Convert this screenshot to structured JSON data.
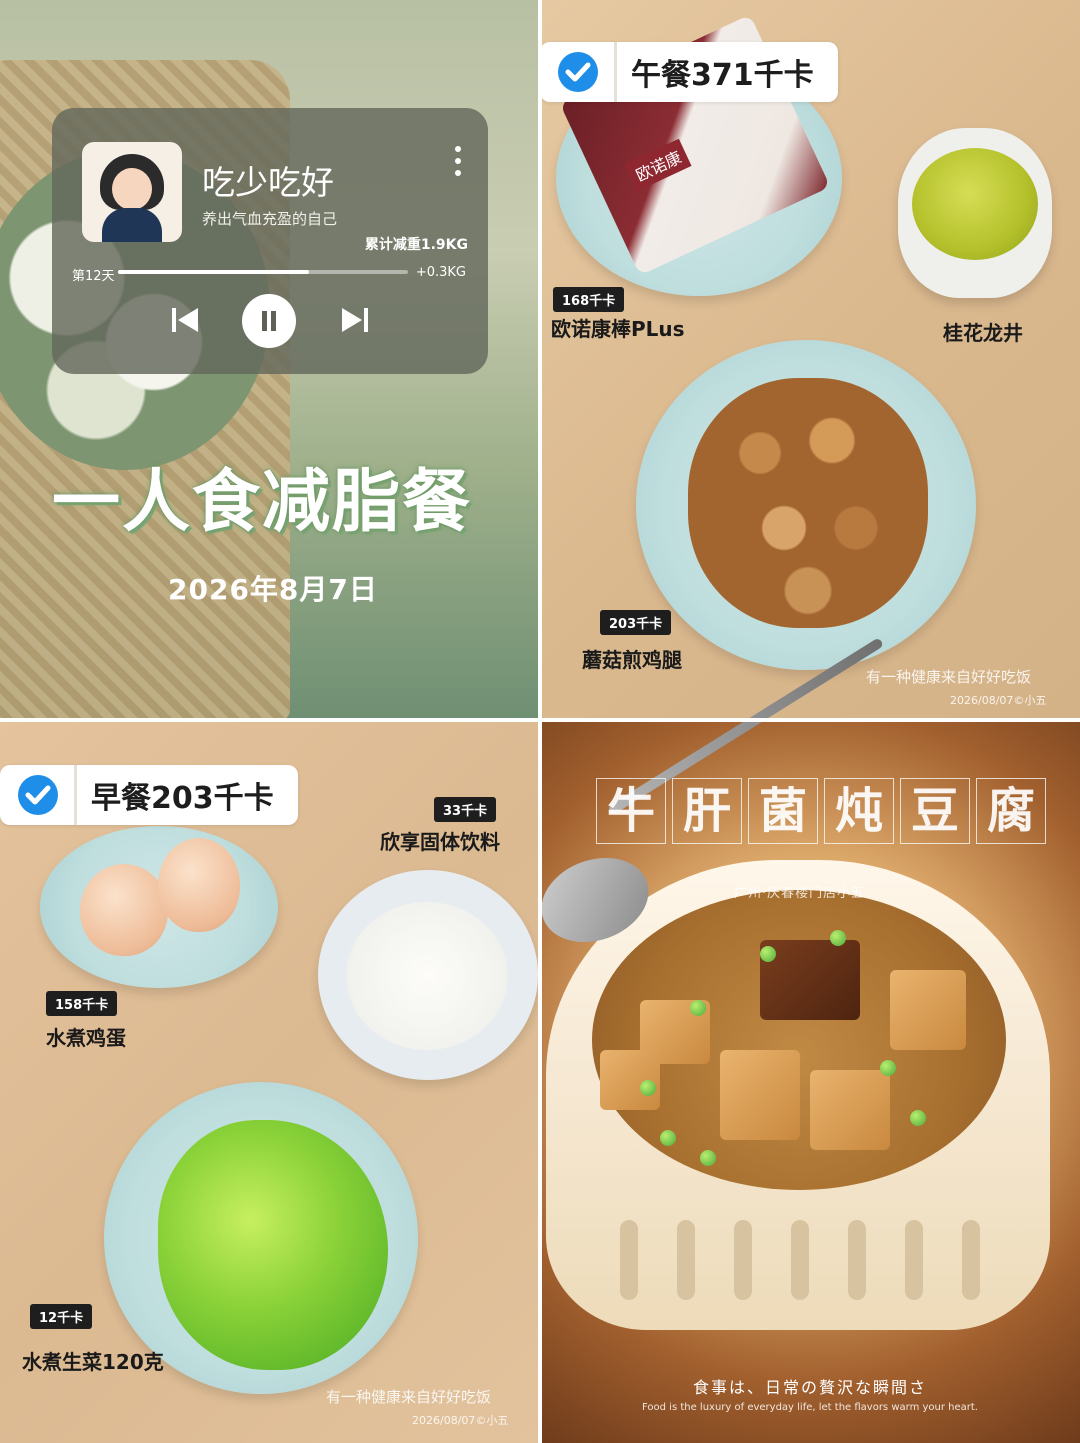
{
  "player": {
    "title": "吃少吃好",
    "subtitle": "养出气血充盈的自己",
    "stat_main": "累计减重1.9KG",
    "day_label": "第12天",
    "stat_right": "+0.3KG",
    "progress": 0.66
  },
  "cover": {
    "title": "一人食减脂餐",
    "date": "2026年8月7日"
  },
  "lunch": {
    "badge": "午餐371千卡",
    "items": [
      {
        "kcal": "168千卡",
        "name": "欧诺康棒PLus"
      },
      {
        "kcal": "",
        "name": "桂花龙井"
      },
      {
        "kcal": "203千卡",
        "name": "蘑菇煎鸡腿"
      }
    ],
    "snack_logo": "欧诺康",
    "watermark_line1": "有一种健康来自好好吃饭",
    "watermark_line2": "2026/08/07©小五"
  },
  "breakfast": {
    "badge": "早餐203千卡",
    "items": [
      {
        "kcal": "33千卡",
        "name": "欣享固体饮料"
      },
      {
        "kcal": "158千卡",
        "name": "水煮鸡蛋"
      },
      {
        "kcal": "12千卡",
        "name": "水煮生菜120克"
      }
    ],
    "watermark_line1": "有一种健康来自好好吃饭",
    "watermark_line2": "2026/08/07©小五"
  },
  "dinner": {
    "title_chars": [
      "牛",
      "肝",
      "菌",
      "炖",
      "豆",
      "腐"
    ],
    "subtitle": "广州·庆春楼门店小五",
    "caption_jp": "食事は、日常の贅沢な瞬間さ",
    "caption_en": "Food is the luxury of everyday life, let the flavors warm your heart."
  },
  "colors": {
    "check_blue": "#1f8ee8",
    "title_green": "#7ca676"
  }
}
